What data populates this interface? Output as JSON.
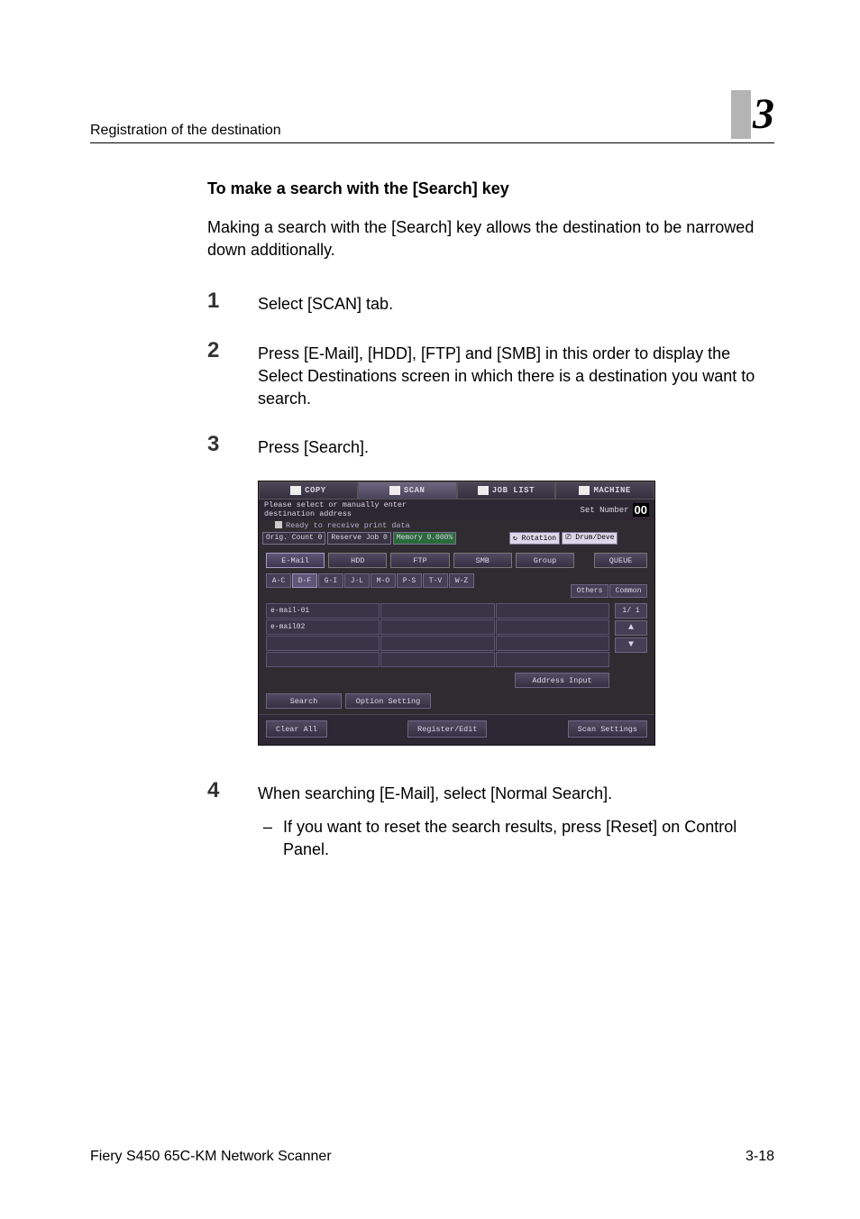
{
  "header": {
    "left": "Registration of the destination",
    "chapter": "3"
  },
  "section": {
    "title": "To make a search with the [Search] key",
    "intro": "Making a search with the [Search] key allows the destination to be narrowed down additionally."
  },
  "steps": [
    {
      "num": "1",
      "text": "Select [SCAN] tab."
    },
    {
      "num": "2",
      "text": "Press [E-Mail], [HDD], [FTP] and [SMB] in this order to display the Select Destinations screen in which there is a destination you want to search."
    },
    {
      "num": "3",
      "text": "Press [Search]."
    },
    {
      "num": "4",
      "text": "When searching [E-Mail], select [Normal Search].",
      "bullet": "If you want to reset the search results, press [Reset] on Control Panel."
    }
  ],
  "footer": {
    "left": "Fiery S450 65C-KM Network Scanner",
    "right": "3-18"
  },
  "screen": {
    "top_tabs": {
      "copy": "COPY",
      "scan": "SCAN",
      "joblist": "JOB LIST",
      "machine": "MACHINE"
    },
    "msg": "Please select or manually enter\ndestination address",
    "set_number_label": "Set Number",
    "set_number_value": "00",
    "ready": "Ready to receive print data",
    "status": {
      "orig_count": "Orig. Count     0",
      "reserve": "Reserve Job     0",
      "memory": "Memory     0.000%",
      "rotation": "Rotation",
      "drum": "Drum/Deve"
    },
    "dest_tabs": {
      "email": "E-Mail",
      "hdd": "HDD",
      "ftp": "FTP",
      "smb": "SMB",
      "group": "Group",
      "queue": "QUEUE"
    },
    "alpha": [
      "A-C",
      "D-F",
      "G-I",
      "J-L",
      "M-O",
      "P-S",
      "T-V",
      "W-Z"
    ],
    "side": {
      "others": "Others",
      "common": "Common"
    },
    "cells": [
      "e-mail-01",
      "",
      "",
      "e-mail02",
      "",
      "",
      "",
      "",
      "",
      "",
      "",
      ""
    ],
    "pager": {
      "page": "1/  1",
      "up": "▲",
      "down": "▼"
    },
    "address_input": "Address Input",
    "search": "Search",
    "option_setting": "Option Setting",
    "clear_all": "Clear All",
    "register_edit": "Register/Edit",
    "scan_settings": "Scan Settings"
  }
}
